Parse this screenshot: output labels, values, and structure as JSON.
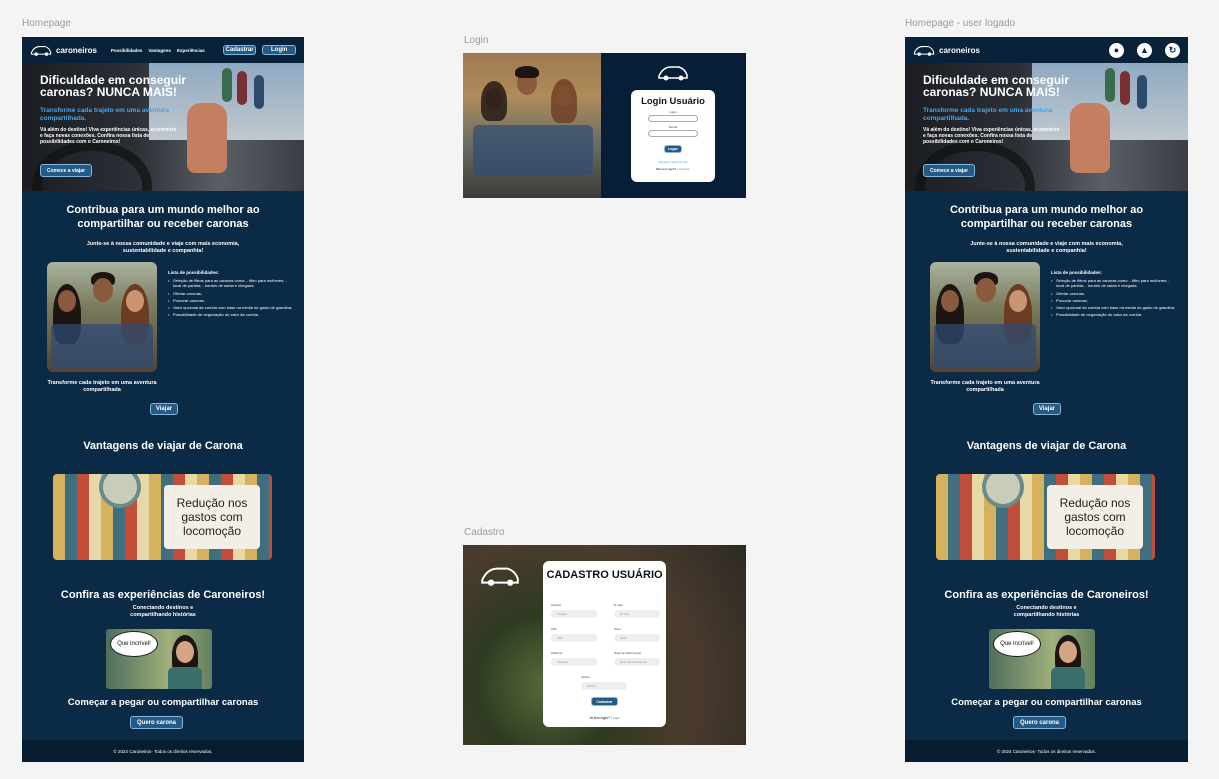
{
  "frames": {
    "homepage": "Homepage",
    "login": "Login",
    "cadastro": "Cadastro",
    "homepage_logged": "Homepage - user logado"
  },
  "brand": "caroneiros",
  "nav": {
    "links": [
      "Possibilidades",
      "Vantagens",
      "Experiências"
    ],
    "signup": "Cadastrar",
    "login": "Login"
  },
  "hero": {
    "title": "Dificuldade em conseguir caronas? NUNCA MAIS!",
    "subtitle": "Transforme cada trajeto em uma aventura compartilhada.",
    "desc": "Vá além do destino! Viva experiências únicas, economize e faça novas conexões. Confira nossa lista de possibilidades com o Caroneiros!",
    "button": "Comece a viajar"
  },
  "contrib": {
    "title": "Contribua para um mundo melhor ao compartilhar ou receber caronas",
    "subtitle": "Junte-se à nossa comunidade e viaje com mais economia, sustentabilidade e companhia!",
    "list_title": "Lista de possibilidades:",
    "items": [
      "Seleção de filtros para as caronas como: - filtro para mulheres; - local de partida; - horário de saída e chegada.",
      "Ofertar caronas;",
      "Procurar caronas;",
      "Valor opcional da corrida com base na média do gasto de gasolina;",
      "Possibilidade de negociação do valor da corrida."
    ],
    "caption": "Transforme cada trajeto em uma aventura compartilhada",
    "button": "Viajar"
  },
  "advantages": {
    "title": "Vantagens de viajar de Carona",
    "card": "Redução nos gastos com locomoção"
  },
  "experiences": {
    "title": "Confira as experiências de Caroneiros!",
    "subtitle": "Conectando destinos e compartilhando histórias",
    "bubble": "Que incrível!"
  },
  "cta": {
    "title": "Começar a pegar ou compartilhar caronas",
    "button": "Quero carona"
  },
  "footer": "© 2024 Caroneiros- Todos os direitos reservados.",
  "login": {
    "title": "Login Usuário",
    "user_label": "Login",
    "pass_label": "Senha",
    "button": "Logar",
    "forgot": "Esqueci minha senha",
    "no_account": "Não tem login?",
    "signup_link": "Cadastrar"
  },
  "cadastro": {
    "title": "CADASTRO USUÁRIO",
    "fields": [
      {
        "label": "Usuário",
        "placeholder": "Usuário"
      },
      {
        "label": "E-mail",
        "placeholder": "E-mail"
      },
      {
        "label": "CPF",
        "placeholder": "CPF"
      },
      {
        "label": "Sexo",
        "placeholder": "Sexo"
      },
      {
        "label": "Telefone",
        "placeholder": "Telefone"
      },
      {
        "label": "Data de Nascimento",
        "placeholder": "Data de Nascimento"
      },
      {
        "label": "Senha",
        "placeholder": "Senha"
      }
    ],
    "button": "Cadastrar",
    "have_login": "Já tem login?",
    "login_link": "Logar"
  },
  "logged_icons": [
    "user-icon",
    "car-icon",
    "history-icon"
  ],
  "colors": {
    "background": "#0b2a45",
    "accent": "#4aa3e8",
    "button": "#245a86"
  }
}
